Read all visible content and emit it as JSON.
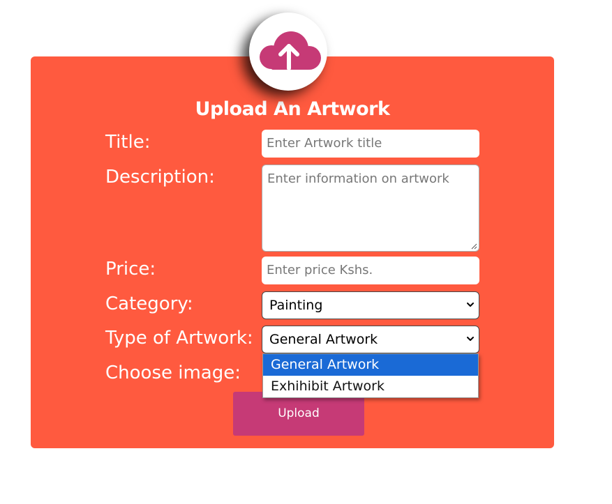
{
  "form": {
    "heading": "Upload An Artwork",
    "title_label": "Title:",
    "title_placeholder": "Enter Artwork title",
    "description_label": "Description:",
    "description_placeholder": "Enter information on artwork",
    "price_label": "Price:",
    "price_placeholder": "Enter price Kshs.",
    "category_label": "Category:",
    "category_value": "Painting",
    "type_label": "Type of Artwork:",
    "type_value": "General Artwork",
    "type_options": [
      "General Artwork",
      "Exhihibit Artwork"
    ],
    "image_label": "Choose image:",
    "submit_label": "Upload"
  },
  "icons": {
    "upload": "cloud-upload-icon",
    "select_chevron": "chevron-down-icon"
  },
  "colors": {
    "card_background": "#ff5a3f",
    "accent": "#c63a76",
    "highlight": "#1a6ad6"
  }
}
